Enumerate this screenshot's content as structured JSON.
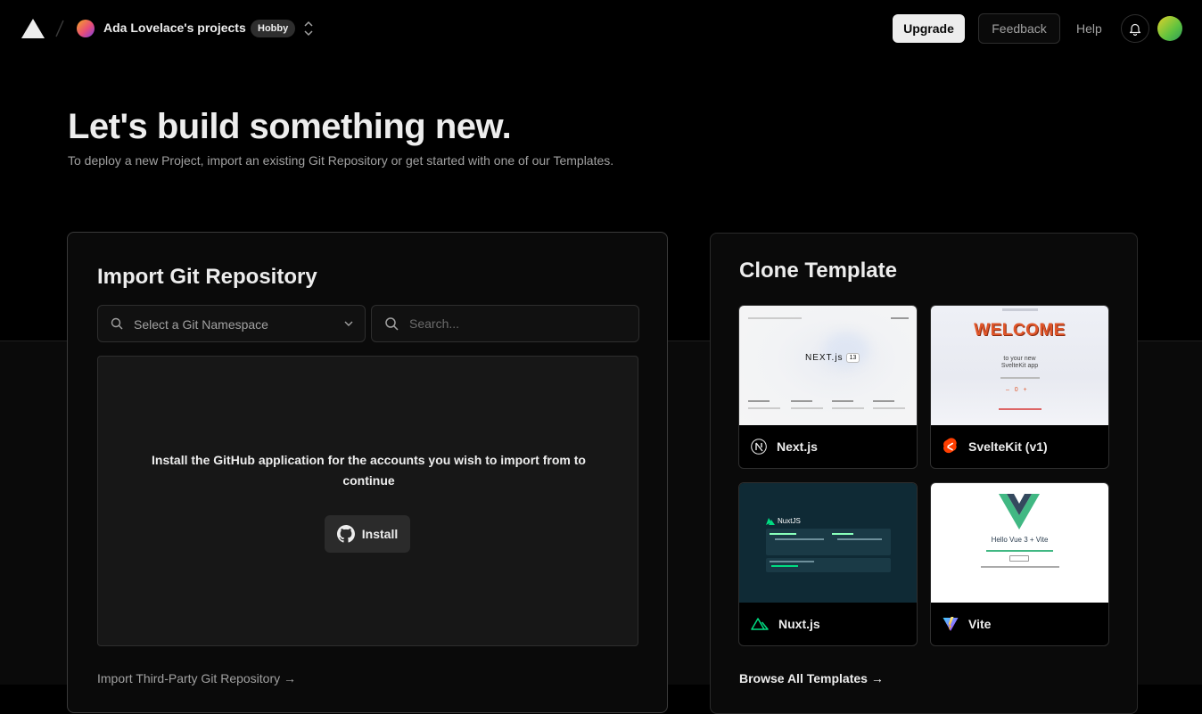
{
  "header": {
    "team_name": "Ada Lovelace's projects",
    "plan_badge": "Hobby",
    "upgrade_label": "Upgrade",
    "feedback_label": "Feedback",
    "help_label": "Help"
  },
  "hero": {
    "title": "Let's build something new.",
    "subtitle": "To deploy a new Project, import an existing Git Repository or get started with one of our Templates."
  },
  "import": {
    "title": "Import Git Repository",
    "namespace_placeholder": "Select a Git Namespace",
    "search_placeholder": "Search...",
    "install_message": "Install the GitHub application for the accounts you wish to import from to continue",
    "install_label": "Install",
    "third_party_link": "Import Third-Party Git Repository →"
  },
  "clone": {
    "title": "Clone Template",
    "templates": [
      {
        "name": "Next.js",
        "icon": "nextjs-icon"
      },
      {
        "name": "SvelteKit (v1)",
        "icon": "svelte-icon"
      },
      {
        "name": "Nuxt.js",
        "icon": "nuxt-icon"
      },
      {
        "name": "Vite",
        "icon": "vite-icon"
      }
    ],
    "previews": {
      "next_brand": "NEXT.js",
      "next_version": "13",
      "svelte_welcome": "WELCOME",
      "svelte_line1": "to your new",
      "svelte_line2": "SvelteKit app",
      "nuxt_brand": "NuxtJS",
      "vite_heading": "Hello Vue 3 + Vite"
    },
    "browse_link": "Browse All Templates →"
  },
  "colors": {
    "background": "#000000",
    "panel": "#0a0a0a",
    "text": "#ededed",
    "muted": "#a1a1a1",
    "svelte": "#ff3e00",
    "nuxt": "#00dc82",
    "vue_green": "#41b883",
    "vue_dark": "#34495e"
  }
}
